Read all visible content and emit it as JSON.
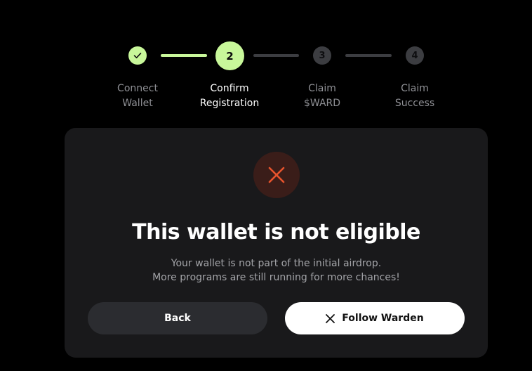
{
  "stepper": {
    "steps": [
      {
        "number": "",
        "label": "Connect\nWallet",
        "state": "completed",
        "icon": "checkmark-icon"
      },
      {
        "number": "2",
        "label": "Confirm\nRegistration",
        "state": "active"
      },
      {
        "number": "3",
        "label": "Claim\n$WARD",
        "state": "pending"
      },
      {
        "number": "4",
        "label": "Claim\nSuccess",
        "state": "pending"
      }
    ]
  },
  "result": {
    "icon": "close-x-icon",
    "title": "This wallet is not eligible",
    "subtitle_line1": "Your wallet is not part of the initial airdrop.",
    "subtitle_line2": "More programs are still running for more chances!"
  },
  "actions": {
    "back_label": "Back",
    "follow_label": "Follow Warden",
    "follow_icon": "x-logo-icon"
  },
  "colors": {
    "accent": "#c8f79a",
    "error": "#e5532d",
    "card_bg": "#19191b",
    "page_bg": "#000000"
  }
}
